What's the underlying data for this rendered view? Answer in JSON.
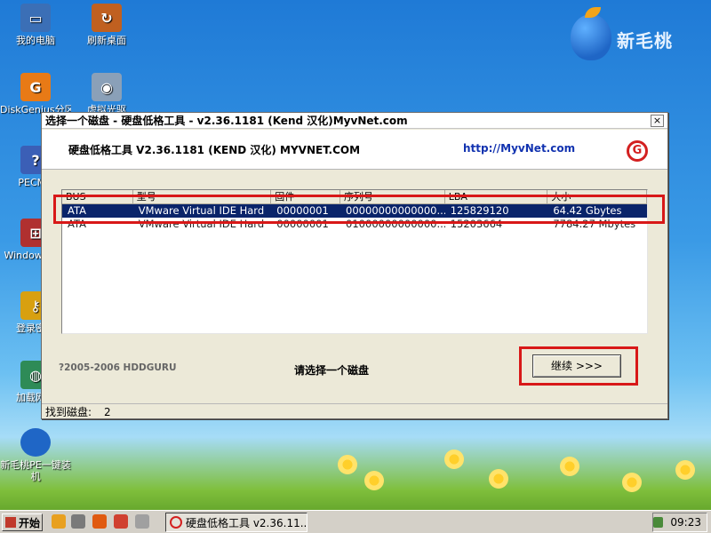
{
  "brand": {
    "text": "新毛桃"
  },
  "desktop": {
    "icons": [
      {
        "label": "我的电脑",
        "color": "#3b6fb6"
      },
      {
        "label": "刷新桌面",
        "color": "#c06020"
      },
      {
        "label": "DiskGenius分区工具",
        "color": "#e87a16"
      },
      {
        "label": "虚拟光驱",
        "color": "#8aa0b8"
      },
      {
        "label": "PECMD",
        "color": "#3b5fb6"
      },
      {
        "label": "Windows引导",
        "color": "#b03030"
      },
      {
        "label": "登录密码",
        "color": "#d8a010"
      },
      {
        "label": "加载网络",
        "color": "#2e8b57"
      },
      {
        "label": "新毛桃PE一键装机",
        "color": "#1f66c6"
      }
    ]
  },
  "window": {
    "title": "选择一个磁盘 - 硬盘低格工具 - v2.36.1181 (Kend 汉化)MyvNet.com",
    "close_label": "×",
    "header_title": "硬盘低格工具 V2.36.1181 (KEND 汉化) MYVNET.COM",
    "header_url": "http://MyvNet.com",
    "columns": [
      "BUS",
      "型号",
      "固件",
      "序列号",
      "LBA",
      "大小"
    ],
    "rows": [
      {
        "bus": "ATA",
        "model": "VMware Virtual IDE Hard",
        "firmware": "00000001",
        "serial": "00000000000000...",
        "lba": "125829120",
        "size": "64.42 Gbytes",
        "selected": true
      },
      {
        "bus": "ATA",
        "model": "VMware Virtual IDE Hard",
        "firmware": "00000001",
        "serial": "01000000000000...",
        "lba": "15203664",
        "size": "7784.27 Mbytes",
        "selected": false
      }
    ],
    "copyright": "?2005-2006 HDDGURU",
    "prompt": "请选择一个磁盘",
    "continue_label": "继续 >>>",
    "status_label": "找到磁盘:",
    "status_value": "2"
  },
  "taskbar": {
    "start_label": "开始",
    "task_label": "硬盘低格工具 v2.36.11...",
    "clock": "09:23"
  }
}
